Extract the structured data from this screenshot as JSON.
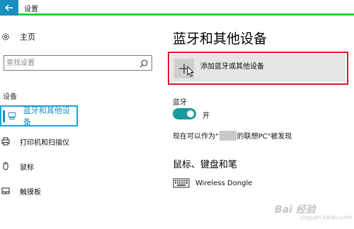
{
  "window": {
    "title": "设置"
  },
  "sidebar": {
    "home_label": "主页",
    "search_placeholder": "查找设置",
    "section_label": "设备",
    "items": [
      {
        "label": "蓝牙和其他设备",
        "icon": "bluetooth-devices-icon",
        "active": true
      },
      {
        "label": "打印机和扫描仪",
        "icon": "printer-icon",
        "active": false
      },
      {
        "label": "鼠标",
        "icon": "mouse-icon",
        "active": false
      },
      {
        "label": "触摸板",
        "icon": "touchpad-icon",
        "active": false
      }
    ]
  },
  "main": {
    "title": "蓝牙和其他设备",
    "add_device_label": "添加蓝牙或其他设备",
    "bluetooth_label": "蓝牙",
    "bluetooth_toggle_state": "开",
    "discoverable_prefix": "现在可以作为\"",
    "discoverable_suffix": "的联想PC\"被发现",
    "mouse_section_title": "鼠标、键盘和笔",
    "device_name": "Wireless Dongle"
  },
  "watermark": {
    "text": "Bai 经验",
    "sub": "jingyan.baidu.com"
  },
  "colors": {
    "accent": "#1a8fbd",
    "highlight_red": "#e8102a",
    "highlight_blue": "#18a4dd",
    "highlight_green": "#22d431",
    "toggle_on": "#1a9a9c"
  }
}
